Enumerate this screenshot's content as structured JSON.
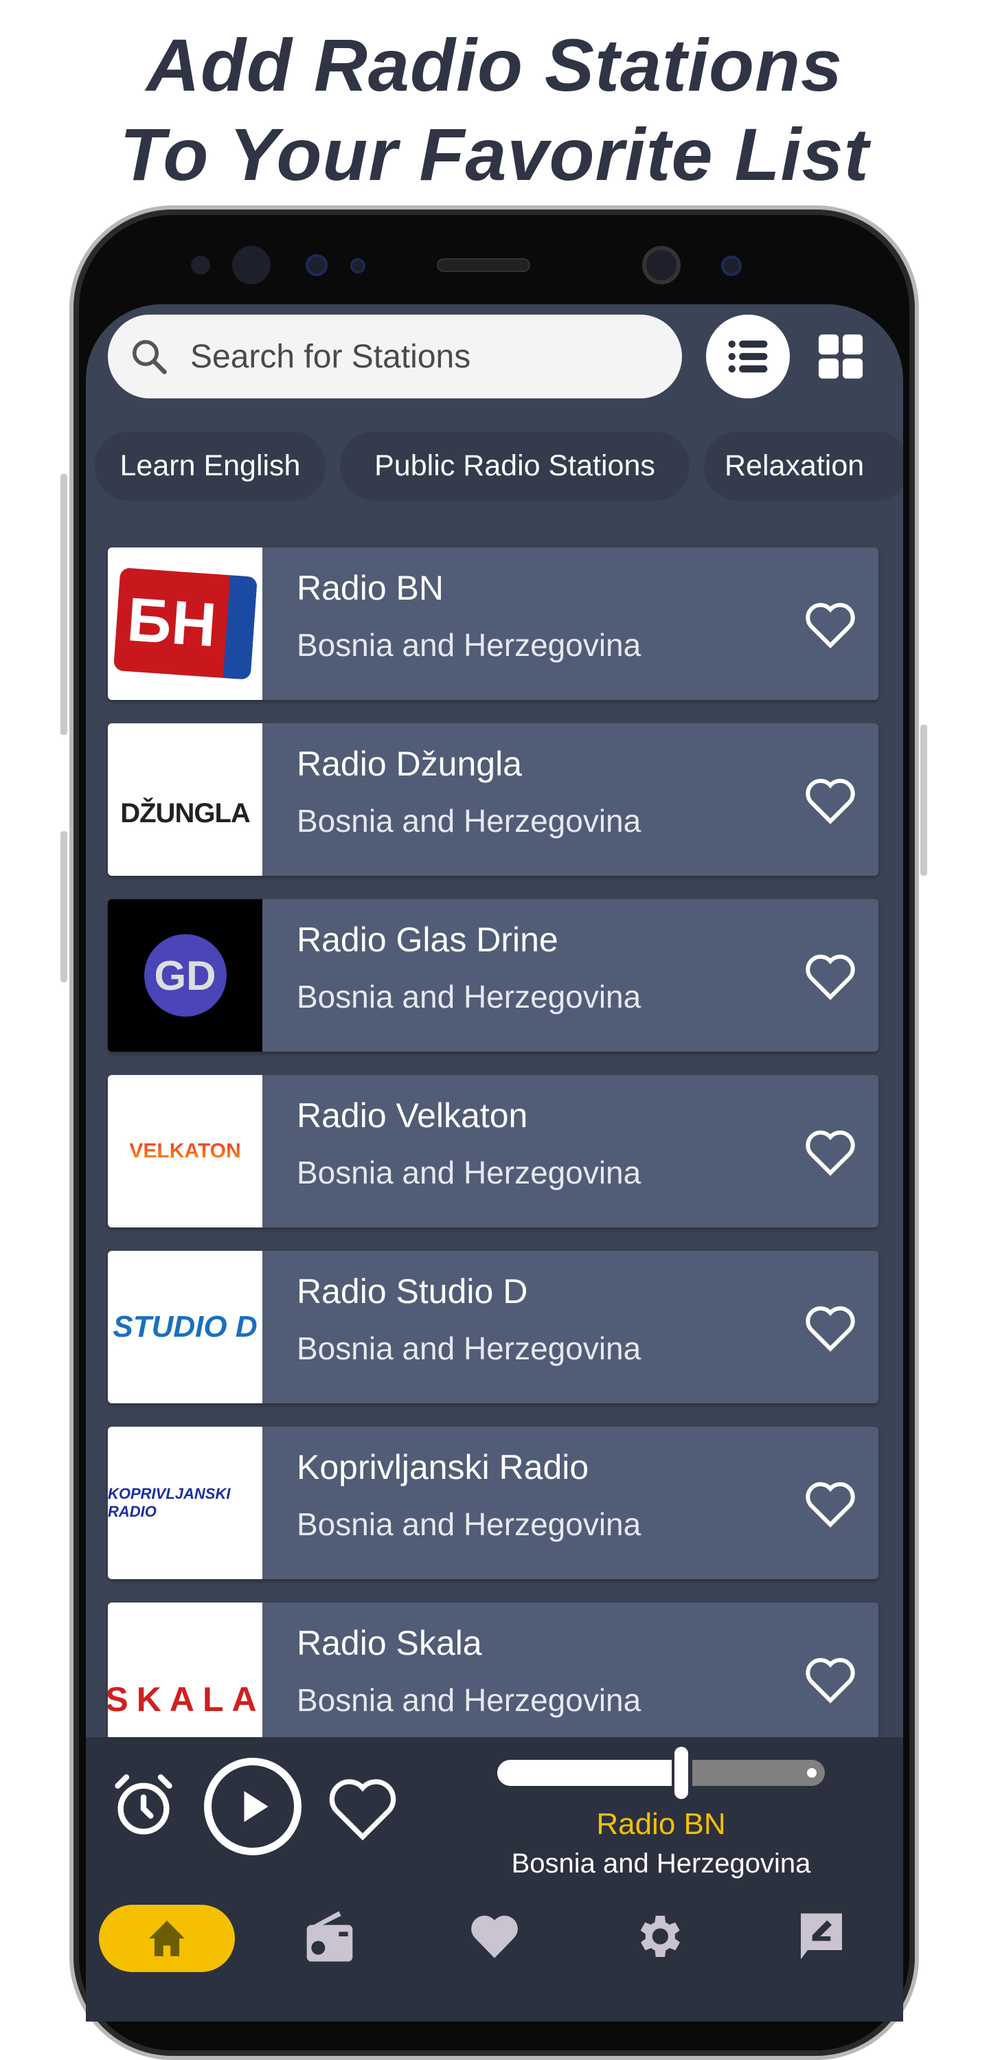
{
  "headline": {
    "line1": "Add Radio Stations",
    "line2": "To Your Favorite List"
  },
  "search": {
    "placeholder": "Search for Stations",
    "icon": "search-icon"
  },
  "view_toggle": {
    "list": "list-view-icon",
    "grid": "grid-view-icon",
    "active": "list"
  },
  "chips": [
    "Learn English",
    "Public Radio Stations",
    "Relaxation"
  ],
  "stations": [
    {
      "name": "Radio BN",
      "country": "Bosnia and Herzegovina",
      "logo_text": "БН"
    },
    {
      "name": "Radio Džungla",
      "country": "Bosnia and Herzegovina",
      "logo_text": "DŽUNGLA"
    },
    {
      "name": "Radio Glas Drine",
      "country": "Bosnia and Herzegovina",
      "logo_text": "GD"
    },
    {
      "name": "Radio Velkaton",
      "country": "Bosnia and Herzegovina",
      "logo_text": "VELKATON"
    },
    {
      "name": "Radio Studio D",
      "country": "Bosnia and Herzegovina",
      "logo_text": "STUDIO D"
    },
    {
      "name": "Koprivljanski Radio",
      "country": "Bosnia and Herzegovina",
      "logo_text": "KOPRIVLJANSKI RADIO"
    },
    {
      "name": "Radio Skala",
      "country": "Bosnia and Herzegovina",
      "logo_text": "SKALA"
    }
  ],
  "player": {
    "station": "Radio BN",
    "country": "Bosnia and Herzegovina",
    "volume_percent": 55
  },
  "nav": {
    "items": [
      "home",
      "radio",
      "favorites",
      "settings",
      "feedback"
    ],
    "active": "home"
  },
  "colors": {
    "accent": "#f5c000",
    "background": "#3b4356",
    "card": "#515c76",
    "player": "#2c3140",
    "headline": "#2f3545"
  }
}
